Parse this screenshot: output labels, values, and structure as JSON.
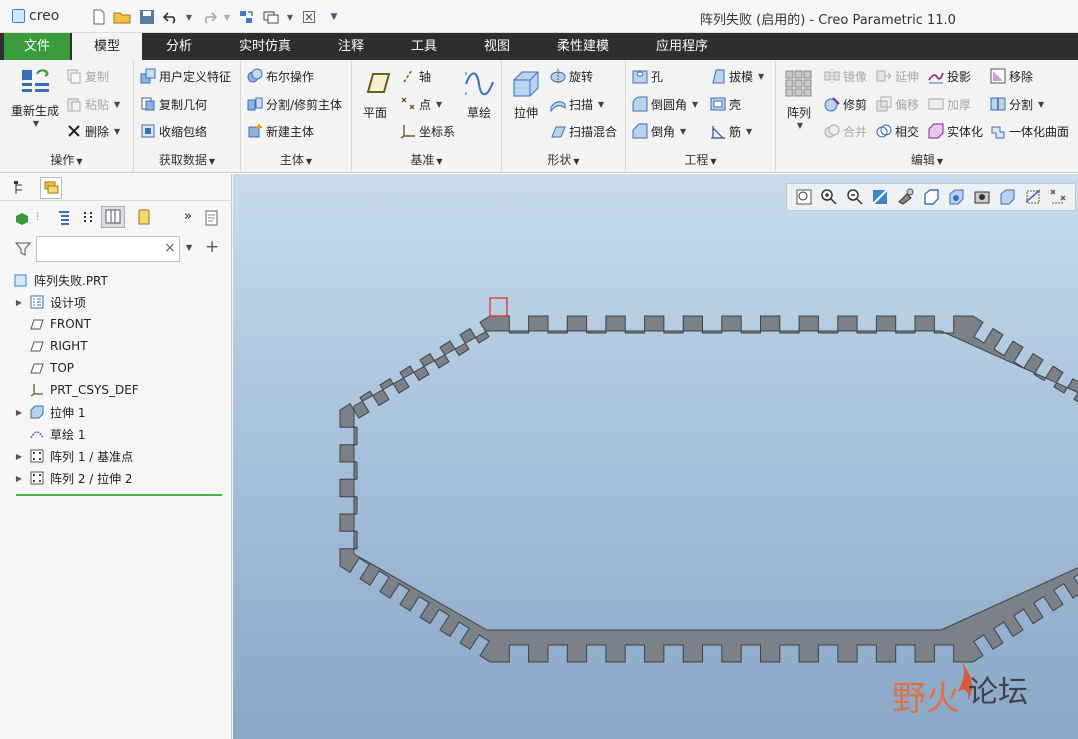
{
  "titlebar": {
    "logo_text": "creo",
    "window_title": "阵列失败 (启用的) - Creo Parametric 11.0"
  },
  "menu": {
    "tabs": [
      "文件",
      "模型",
      "分析",
      "实时仿真",
      "注释",
      "工具",
      "视图",
      "柔性建模",
      "应用程序"
    ],
    "active": "模型"
  },
  "ribbon": {
    "operations": {
      "label": "操作",
      "regenerate": "重新生成",
      "copy": "复制",
      "paste": "粘贴",
      "delete": "删除"
    },
    "get_data": {
      "label": "获取数据",
      "user_defined_feature": "用户定义特征",
      "copy_geometry": "复制几何",
      "shrinkwrap": "收缩包络"
    },
    "body": {
      "label": "主体",
      "boolean": "布尔操作",
      "split_trim": "分割/修剪主体",
      "new_body": "新建主体"
    },
    "datum": {
      "label": "基准",
      "plane": "平面",
      "axis": "轴",
      "point": "点",
      "csys": "坐标系",
      "sketch": "草绘"
    },
    "shapes": {
      "label": "形状",
      "extrude": "拉伸",
      "revolve": "旋转",
      "sweep": "扫描",
      "swept_blend": "扫描混合"
    },
    "engineering": {
      "label": "工程",
      "hole": "孔",
      "round": "倒圆角",
      "chamfer": "倒角",
      "draft": "拔模",
      "shell": "壳",
      "rib": "筋"
    },
    "editing": {
      "label": "编辑",
      "pattern": "阵列",
      "mirror": "镜像",
      "trim": "修剪",
      "merge": "合并",
      "extend": "延伸",
      "offset": "偏移",
      "intersect": "相交",
      "project": "投影",
      "thicken": "加厚",
      "solidify": "实体化",
      "remove": "移除",
      "split": "分割",
      "unify_surface": "一体化曲面"
    }
  },
  "model_tree": {
    "filter_placeholder": "",
    "items": [
      {
        "label": "阵列失败.PRT",
        "icon": "part-icon"
      },
      {
        "label": "设计项",
        "icon": "design-items-icon"
      },
      {
        "label": "FRONT",
        "icon": "datum-plane-icon"
      },
      {
        "label": "RIGHT",
        "icon": "datum-plane-icon"
      },
      {
        "label": "TOP",
        "icon": "datum-plane-icon"
      },
      {
        "label": "PRT_CSYS_DEF",
        "icon": "csys-icon"
      },
      {
        "label": "拉伸 1",
        "icon": "extrude-icon"
      },
      {
        "label": "草绘 1",
        "icon": "sketch-icon"
      },
      {
        "label": "阵列 1 / 基准点",
        "icon": "pattern-icon"
      },
      {
        "label": "阵列 2 / 拉伸 2",
        "icon": "pattern-icon"
      }
    ]
  },
  "watermark": {
    "text": "野火论坛"
  },
  "colors": {
    "file_tab": "#3a9c3a",
    "menubar": "#2e2e2e",
    "part_fill": "#7c8188",
    "viewport_top": "#c8dceb",
    "viewport_bottom": "#8aa7c8",
    "insert_line": "#47b047",
    "highlight": "#e03030"
  }
}
